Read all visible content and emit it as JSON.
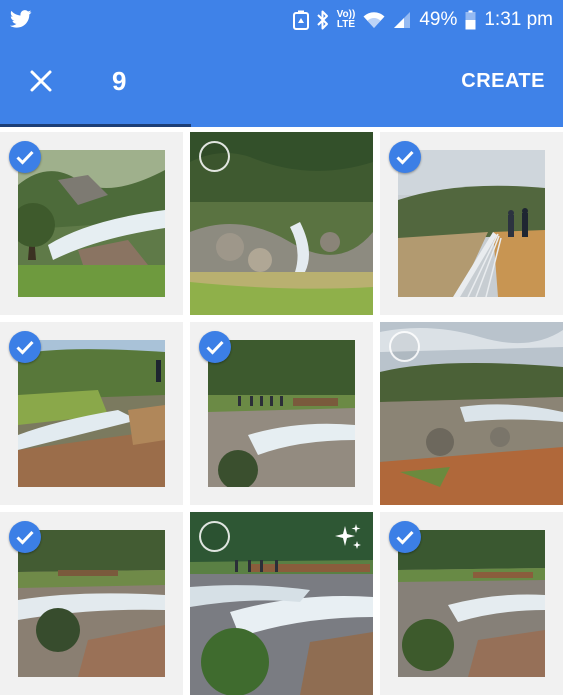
{
  "status_bar": {
    "app_icon": "twitter-bird-icon",
    "icons": [
      "recycle-notification-icon",
      "bluetooth-icon",
      "volte-icon",
      "wifi-icon",
      "cell-signal-icon",
      "battery-icon"
    ],
    "volte_top": "Vo))",
    "volte_bottom": "LTE",
    "battery": "49%",
    "time": "1:31 pm"
  },
  "action_bar": {
    "close_icon": "close-icon",
    "selected_count": "9",
    "create_label": "CREATE",
    "progress_fraction": 0.34
  },
  "colors": {
    "primary": "#3f82e8",
    "check": "#3c7fe6",
    "tile_background": "#f1f1f1"
  },
  "photos": [
    {
      "id": 1,
      "selected": true,
      "scene": "waterfall-with-tree"
    },
    {
      "id": 2,
      "selected": false,
      "scene": "bushland-waterfall-rocks"
    },
    {
      "id": 3,
      "selected": true,
      "scene": "people-on-walkway-railing"
    },
    {
      "id": 4,
      "selected": true,
      "scene": "cascading-water-over-rocks"
    },
    {
      "id": 5,
      "selected": true,
      "scene": "people-at-bridge-over-rocks"
    },
    {
      "id": 6,
      "selected": false,
      "scene": "river-rocks-cloudy-sky"
    },
    {
      "id": 7,
      "selected": true,
      "scene": "rocky-river-with-bridge"
    },
    {
      "id": 8,
      "selected": false,
      "scene": "rapids-with-people-on-bridge",
      "badge": "sparkle-icon"
    },
    {
      "id": 9,
      "selected": true,
      "scene": "rapids-and-bridge-wide"
    }
  ]
}
